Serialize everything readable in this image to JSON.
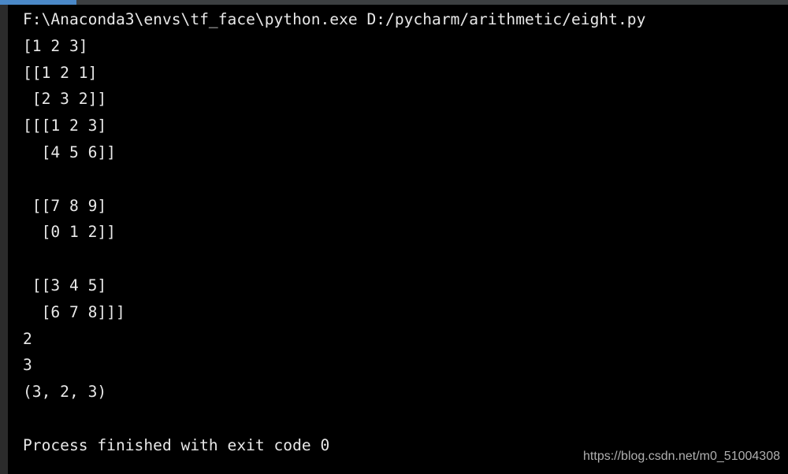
{
  "console": {
    "lines": [
      "F:\\Anaconda3\\envs\\tf_face\\python.exe D:/pycharm/arithmetic/eight.py",
      "[1 2 3]",
      "[[1 2 1]",
      " [2 3 2]]",
      "[[[1 2 3]",
      "  [4 5 6]]",
      "",
      " [[7 8 9]",
      "  [0 1 2]]",
      "",
      " [[3 4 5]",
      "  [6 7 8]]]",
      "2",
      "3",
      "(3, 2, 3)",
      "",
      "Process finished with exit code 0"
    ]
  },
  "watermark": "https://blog.csdn.net/m0_51004308",
  "colors": {
    "background": "#000000",
    "text": "#e8e8e8",
    "accent": "#4a88c7"
  }
}
